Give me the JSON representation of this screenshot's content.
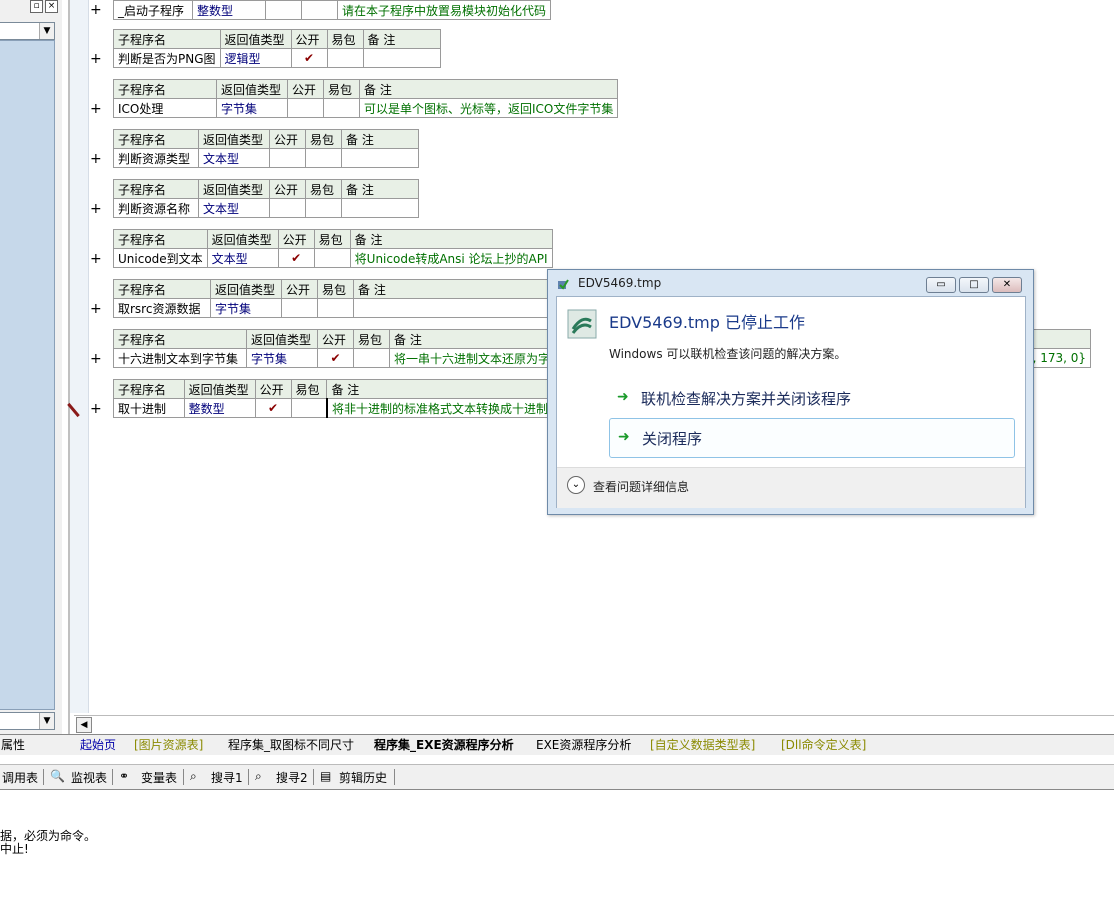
{
  "left_panel": {
    "tab_label": "属性"
  },
  "rows": [
    {
      "headers": [],
      "cells": [
        "_启动子程序",
        "整数型",
        "",
        "",
        "请在本子程序中放置易模块初始化代码"
      ]
    },
    {
      "headers": [
        "子程序名",
        "返回值类型",
        "公开",
        "易包",
        "备 注"
      ],
      "cells": [
        "判断是否为PNG图",
        "逻辑型",
        "✔",
        "",
        ""
      ]
    },
    {
      "headers": [
        "子程序名",
        "返回值类型",
        "公开",
        "易包",
        "备 注"
      ],
      "cells": [
        "ICO处理",
        "字节集",
        "",
        "",
        "可以是单个图标、光标等，返回ICO文件字节集"
      ]
    },
    {
      "headers": [
        "子程序名",
        "返回值类型",
        "公开",
        "易包",
        "备 注"
      ],
      "cells": [
        "判断资源类型",
        "文本型",
        "",
        "",
        ""
      ]
    },
    {
      "headers": [
        "子程序名",
        "返回值类型",
        "公开",
        "易包",
        "备 注"
      ],
      "cells": [
        "判断资源名称",
        "文本型",
        "",
        "",
        ""
      ]
    },
    {
      "headers": [
        "子程序名",
        "返回值类型",
        "公开",
        "易包",
        "备 注"
      ],
      "cells": [
        "Unicode到文本",
        "文本型",
        "✔",
        "",
        "将Unicode转成Ansi 论坛上抄的API"
      ]
    },
    {
      "headers": [
        "子程序名",
        "返回值类型",
        "公开",
        "易包",
        "备 注"
      ],
      "cells": [
        "取rsrc资源数据",
        "字节集",
        "",
        "",
        ""
      ]
    },
    {
      "headers": [
        "子程序名",
        "返回值类型",
        "公开",
        "易包",
        "备 注"
      ],
      "cells": [
        "十六进制文本到字节集",
        "字节集",
        "✔",
        "",
        "将一串十六进制文本还原为字"
      ],
      "tail": "91, 173, 0}"
    },
    {
      "headers": [
        "子程序名",
        "返回值类型",
        "公开",
        "易包",
        "备 注"
      ],
      "cells": [
        "取十进制",
        "整数型",
        "✔",
        "",
        "将非十进制的标准格式文本转换成十进制"
      ]
    }
  ],
  "tabs": [
    {
      "label": "起始页"
    },
    {
      "label": "[图片资源表]"
    },
    {
      "label": "程序集_取图标不同尺寸"
    },
    {
      "label": "程序集_EXE资源程序分析"
    },
    {
      "label": "EXE资源程序分析"
    },
    {
      "label": "[自定义数据类型表]"
    },
    {
      "label": "[Dll命令定义表]"
    }
  ],
  "tools": [
    {
      "label": "调用表"
    },
    {
      "label": "监视表"
    },
    {
      "label": "变量表"
    },
    {
      "label": "搜寻1"
    },
    {
      "label": "搜寻2"
    },
    {
      "label": "剪辑历史"
    }
  ],
  "output": [
    "据，必须为命令。",
    "中止!"
  ],
  "dialog": {
    "title": "EDV5469.tmp",
    "heading": "EDV5469.tmp 已停止工作",
    "subtext": "Windows 可以联机检查该问题的解决方案。",
    "option1": "联机检查解决方案并关闭该程序",
    "option2": "关闭程序",
    "details": "查看问题详细信息"
  }
}
